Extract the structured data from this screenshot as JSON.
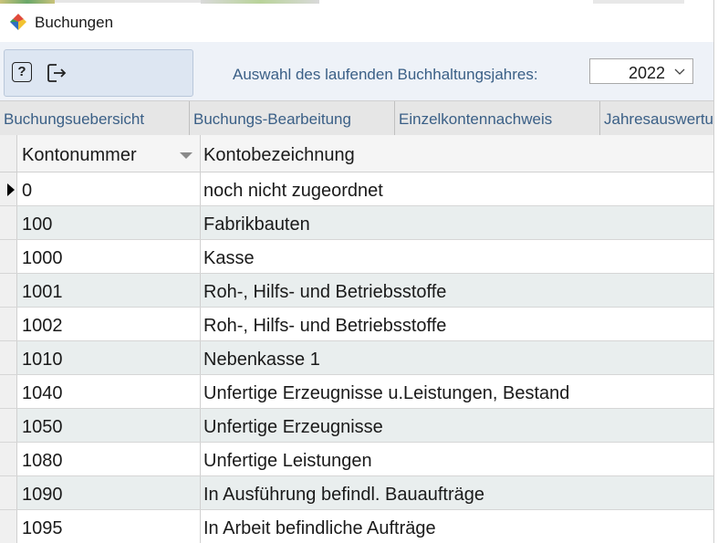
{
  "window": {
    "title": "Buchungen"
  },
  "toolbar": {
    "help_label": "?",
    "year_label": "Auswahl des laufenden Buchhaltungsjahres:",
    "year_value": "2022"
  },
  "tabs": [
    {
      "label": "Buchungsuebersicht"
    },
    {
      "label": "Buchungs-Bearbeitung"
    },
    {
      "label": "Einzelkontennachweis"
    },
    {
      "label": "Jahresauswertu"
    }
  ],
  "grid": {
    "columns": [
      {
        "label": "Kontonummer"
      },
      {
        "label": "Kontobezeichnung"
      }
    ],
    "rows": [
      {
        "kontonummer": "0",
        "bezeichnung": "noch nicht zugeordnet"
      },
      {
        "kontonummer": "100",
        "bezeichnung": "Fabrikbauten"
      },
      {
        "kontonummer": "1000",
        "bezeichnung": "Kasse"
      },
      {
        "kontonummer": "1001",
        "bezeichnung": "Roh-, Hilfs- und Betriebsstoffe"
      },
      {
        "kontonummer": "1002",
        "bezeichnung": "Roh-, Hilfs- und Betriebsstoffe"
      },
      {
        "kontonummer": "1010",
        "bezeichnung": "Nebenkasse 1"
      },
      {
        "kontonummer": "1040",
        "bezeichnung": "Unfertige Erzeugnisse u.Leistungen, Bestand"
      },
      {
        "kontonummer": "1050",
        "bezeichnung": "Unfertige Erzeugnisse"
      },
      {
        "kontonummer": "1080",
        "bezeichnung": "Unfertige Leistungen"
      },
      {
        "kontonummer": "1090",
        "bezeichnung": "In Ausführung befindl. Bauaufträge"
      },
      {
        "kontonummer": "1095",
        "bezeichnung": "In Arbeit befindliche Aufträge"
      }
    ]
  },
  "colors": {
    "accent_text": "#3a5f86",
    "alt_row": "#e9eeee",
    "toolbar_bg": "#eef2f8"
  },
  "icons": {
    "app": "app-logo-icon",
    "help": "help-icon",
    "exit": "exit-icon",
    "dropdown": "chevron-down-icon",
    "sort": "sort-desc-icon",
    "current_row": "row-pointer-icon"
  }
}
